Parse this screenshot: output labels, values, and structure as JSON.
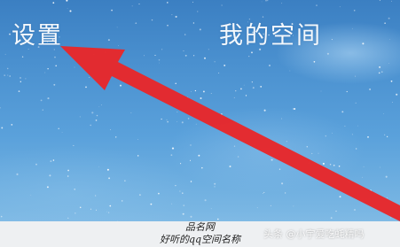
{
  "screen": {
    "settings_label": "设置",
    "my_space_label": "我的空间"
  },
  "annotation": {
    "arrow_color": "#e8262a",
    "arrow_icon": "arrow-up-left-icon"
  },
  "caption": {
    "line1": "品名网",
    "line2": "好听的qq空间名称"
  },
  "watermark": "头条 @小宇爱吃蚝精吗"
}
